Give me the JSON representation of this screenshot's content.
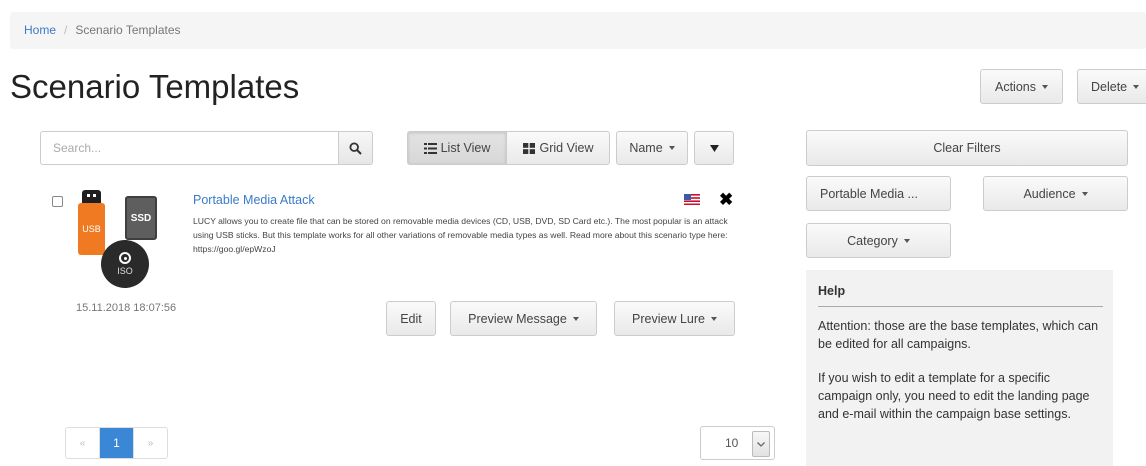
{
  "breadcrumb": {
    "home": "Home",
    "separator": "/",
    "current": "Scenario Templates"
  },
  "page_title": "Scenario Templates",
  "header_actions": {
    "actions_label": "Actions",
    "delete_label": "Delete"
  },
  "toolbar": {
    "search_placeholder": "Search...",
    "list_view_label": "List View",
    "grid_view_label": "Grid View",
    "sort_label": "Name",
    "active_view": "list"
  },
  "template_item": {
    "title": "Portable Media Attack",
    "description": "LUCY allows you to create file that can be stored on removable media devices (CD, USB, DVD, SD Card etc.). The most popular is an attack using USB sticks. But this template works for all other variations of removable media types as well. Read more about this scenario type here: https://goo.gl/epWzoJ",
    "timestamp": "15.11.2018 18:07:56",
    "usb_label": "USB",
    "ssd_label": "SSD",
    "iso_label": "ISO",
    "flag_icon": "us-flag-icon",
    "edit_label": "Edit",
    "preview_message_label": "Preview Message",
    "preview_lure_label": "Preview Lure"
  },
  "pagination": {
    "prev": "«",
    "current_page": "1",
    "next": "»"
  },
  "page_size": {
    "value": "10"
  },
  "filters": {
    "clear_label": "Clear Filters",
    "portable_media_label": "Portable Media ...",
    "audience_label": "Audience",
    "category_label": "Category"
  },
  "help": {
    "title": "Help",
    "paragraph1": "Attention: those are the base templates, which can be edited for all campaigns.",
    "paragraph2": "If you wish to edit a template for a specific campaign only, you need to edit the landing page and e-mail within the campaign base settings."
  },
  "colors": {
    "link": "#3a7bc8",
    "usb": "#f07a22",
    "active_page": "#3a87d6"
  }
}
